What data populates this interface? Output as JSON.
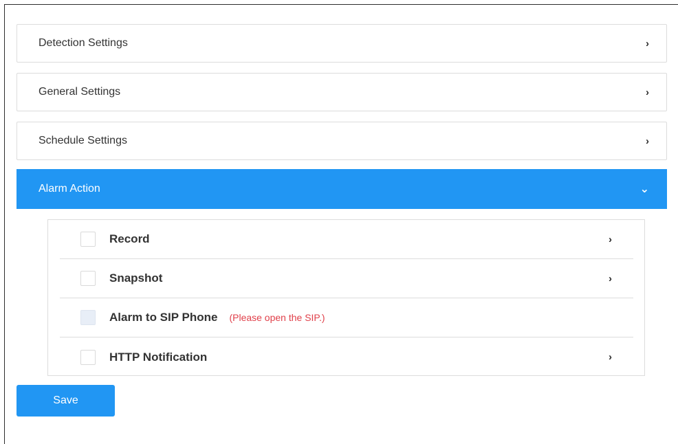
{
  "panels": [
    {
      "label": "Detection Settings",
      "icon": "chevron-right-icon",
      "glyph": "›"
    },
    {
      "label": "General Settings",
      "icon": "chevron-right-icon",
      "glyph": "›"
    },
    {
      "label": "Schedule Settings",
      "icon": "chevron-right-icon",
      "glyph": "›"
    },
    {
      "label": "Alarm Action",
      "icon": "chevron-down-icon",
      "glyph": "⌄",
      "expanded": true
    }
  ],
  "alarm_actions": [
    {
      "label": "Record",
      "checked": false,
      "expandable": true,
      "glyph": "›"
    },
    {
      "label": "Snapshot",
      "checked": false,
      "expandable": true,
      "glyph": "›"
    },
    {
      "label": "Alarm to SIP Phone",
      "checked": false,
      "disabled": true,
      "note": "(Please open the SIP.)"
    },
    {
      "label": "HTTP Notification",
      "checked": false,
      "expandable": true,
      "glyph": "›"
    }
  ],
  "save_label": "Save",
  "colors": {
    "accent": "#2196f3",
    "warning_text": "#e0404a",
    "border": "#dcdcdc"
  }
}
